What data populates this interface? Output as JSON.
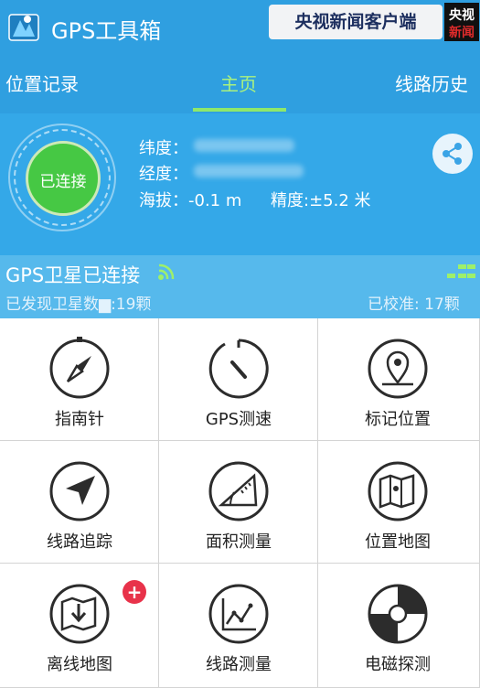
{
  "app": {
    "title": "GPS工具箱"
  },
  "watermark": {
    "text": "央视新闻客户端",
    "logo_line1": "央视",
    "logo_line2": "新闻"
  },
  "tabs": [
    {
      "label": "位置记录",
      "active": false
    },
    {
      "label": "主页",
      "active": true
    },
    {
      "label": "线路历史",
      "active": false
    }
  ],
  "status": {
    "connect_label": "已连接",
    "lat_label": "纬度：",
    "lon_label": "经度：",
    "altitude_text": "海拔：-0.1 m",
    "accuracy_text": "精度:±5.2 米"
  },
  "gps": {
    "title": "GPS卫星已连接",
    "found_text": "已发现卫星数▆:19颗",
    "calibrated_text": "已校准: 17颗"
  },
  "tools": [
    {
      "label": "指南针",
      "icon": "compass-icon"
    },
    {
      "label": "GPS测速",
      "icon": "speedometer-icon"
    },
    {
      "label": "标记位置",
      "icon": "map-pin-icon"
    },
    {
      "label": "线路追踪",
      "icon": "navigation-arrow-icon"
    },
    {
      "label": "面积测量",
      "icon": "protractor-icon"
    },
    {
      "label": "位置地图",
      "icon": "map-icon"
    },
    {
      "label": "离线地图",
      "icon": "offline-map-icon"
    },
    {
      "label": "线路测量",
      "icon": "route-chart-icon"
    },
    {
      "label": "电磁探测",
      "icon": "radar-icon"
    }
  ],
  "badge": "+",
  "colors": {
    "header": "#2f9fe0",
    "panel": "#34a8e8",
    "strip": "#56b9ec",
    "accent_green": "#46c844",
    "active_tab": "#a9f17f"
  }
}
